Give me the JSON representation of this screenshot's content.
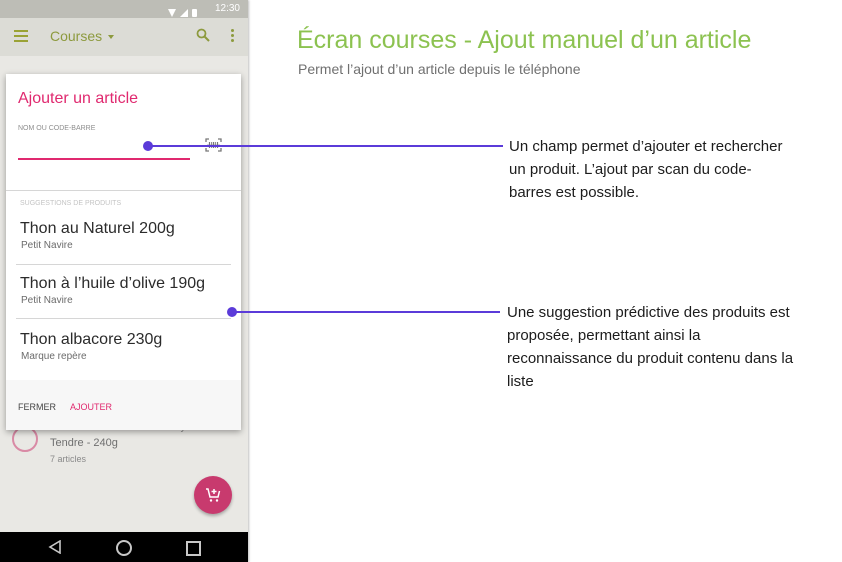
{
  "status_bar": {
    "time": "12:30"
  },
  "app_bar": {
    "title": "Courses"
  },
  "background_item": {
    "line1": "Filet de Poulet Jaune Volandry",
    "line2": "Tendre - 240g",
    "line3": "7 articles"
  },
  "dialog": {
    "title": "Ajouter un article",
    "field_label": "NOM OU CODE-BARRE",
    "field_value": "",
    "suggestions_header": "SUGGESTIONS DE PRODUITS",
    "suggestions": [
      {
        "name": "Thon au Naturel 200g",
        "brand": "Petit Navire"
      },
      {
        "name": "Thon à l’huile d’olive 190g",
        "brand": "Petit Navire"
      },
      {
        "name": "Thon albacore 230g",
        "brand": "Marque repère"
      }
    ],
    "close_label": "FERMER",
    "add_label": "AJOUTER"
  },
  "annotation": {
    "title": "Écran courses - Ajout manuel d’un article",
    "subtitle": "Permet l’ajout d’un article depuis le téléphone",
    "callout1": "Un champ permet d’ajouter et rechercher un produit. L’ajout par scan du code-barres est possible.",
    "callout2": "Une suggestion prédictive des produits est proposée, permettant ainsi la reconnaissance du produit contenu dans la liste"
  },
  "colors": {
    "accent": "#e0296f",
    "title_green": "#8cc250",
    "connector": "#5b3bd9",
    "fab": "#c83a6e"
  },
  "icons": [
    "menu-icon",
    "dropdown-caret-icon",
    "search-icon",
    "more-vert-icon",
    "barcode-scan-icon",
    "add-cart-icon",
    "back-icon",
    "home-icon",
    "recents-icon"
  ]
}
